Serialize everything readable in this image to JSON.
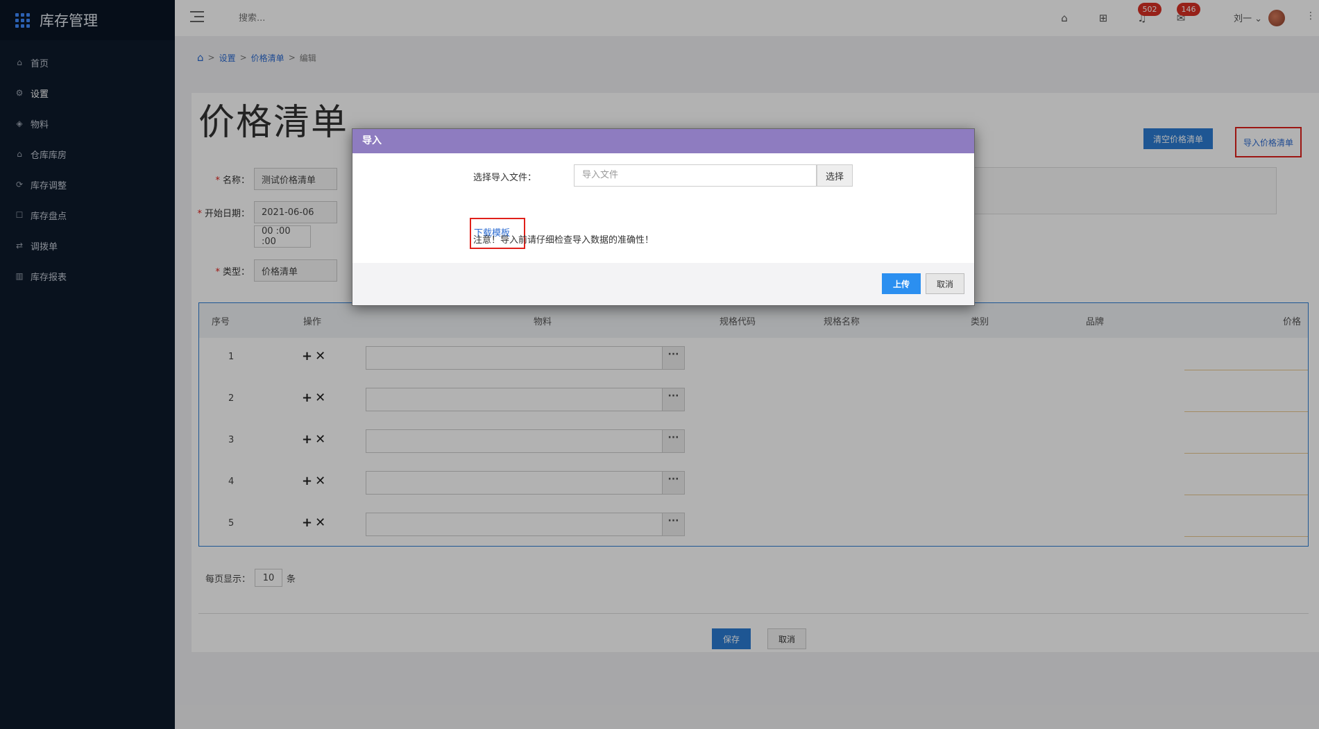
{
  "app": {
    "title": "库存管理"
  },
  "sidebar": {
    "items": [
      {
        "label": "首页",
        "icon": "home-icon"
      },
      {
        "label": "设置",
        "icon": "gear-icon"
      },
      {
        "label": "物料",
        "icon": "cube-icon"
      },
      {
        "label": "仓库库房",
        "icon": "warehouse-icon"
      },
      {
        "label": "库存调整",
        "icon": "adjust-icon"
      },
      {
        "label": "库存盘点",
        "icon": "checklist-icon"
      },
      {
        "label": "调拨单",
        "icon": "transfer-icon"
      },
      {
        "label": "库存报表",
        "icon": "bar-chart-icon"
      }
    ]
  },
  "topbar": {
    "search_placeholder": "搜索...",
    "notifications_count": "502",
    "messages_count": "146",
    "user_name": "刘一"
  },
  "breadcrumb": {
    "items": [
      "设置",
      "价格清单",
      "编辑"
    ]
  },
  "page": {
    "title": "价格清单",
    "clear_button": "清空价格清单",
    "import_button": "导入价格清单"
  },
  "form": {
    "name_label": "名称：",
    "name_value": "测试价格清单",
    "start_label": "开始日期：",
    "start_date": "2021-06-06",
    "start_time": "00 :00 :00",
    "type_label": "类型：",
    "type_value": "价格清单"
  },
  "table": {
    "headers": [
      "序号",
      "操作",
      "物料",
      "规格代码",
      "规格名称",
      "类别",
      "品牌",
      "价格"
    ],
    "rows": [
      "1",
      "2",
      "3",
      "4",
      "5"
    ],
    "add_symbol": "+",
    "remove_symbol": "✕",
    "more_symbol": "···"
  },
  "pager": {
    "label": "每页显示：",
    "value": "10",
    "unit": "条"
  },
  "footer": {
    "save": "保存",
    "cancel": "取消"
  },
  "modal": {
    "title": "导入",
    "file_label": "选择导入文件：",
    "file_placeholder": "导入文件",
    "choose_button": "选择",
    "download_link": "下载模板",
    "note": "注意！导入前请仔细检查导入数据的准确性！",
    "upload_button": "上传",
    "cancel_button": "取消"
  }
}
